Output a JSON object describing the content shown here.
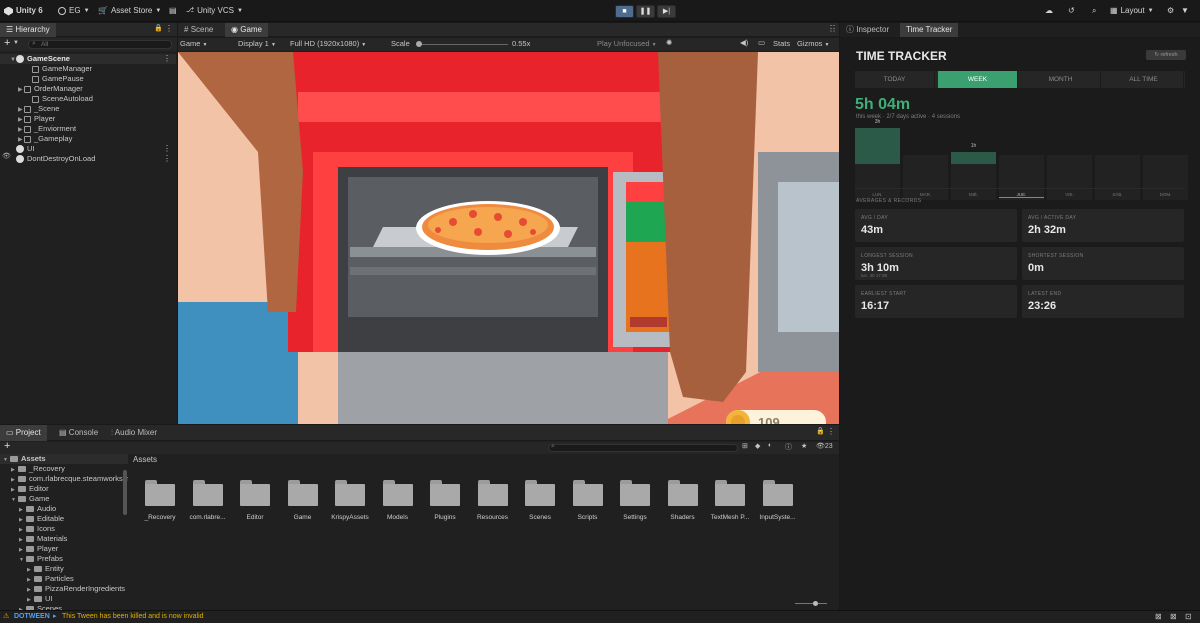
{
  "toolbar": {
    "app": "Unity 6",
    "account": "EG",
    "asset_store": "Asset Store",
    "vcs": "Unity VCS",
    "layout": "Layout"
  },
  "hierarchy": {
    "tab": "Hierarchy",
    "search_placeholder": "All",
    "items": [
      {
        "label": "GameScene",
        "depth": 0,
        "kind": "scene"
      },
      {
        "label": "GameManager",
        "depth": 2,
        "kind": "obj"
      },
      {
        "label": "GamePause",
        "depth": 2,
        "kind": "obj"
      },
      {
        "label": "OrderManager",
        "depth": 1,
        "kind": "obj"
      },
      {
        "label": "SceneAutoload",
        "depth": 2,
        "kind": "obj"
      },
      {
        "label": "_Scene",
        "depth": 1,
        "kind": "obj"
      },
      {
        "label": "Player",
        "depth": 1,
        "kind": "obj"
      },
      {
        "label": "_Enviorment",
        "depth": 1,
        "kind": "obj"
      },
      {
        "label": "_Gameplay",
        "depth": 1,
        "kind": "obj"
      },
      {
        "label": "UI",
        "depth": 0,
        "kind": "unity"
      },
      {
        "label": "DontDestroyOnLoad",
        "depth": 0,
        "kind": "unity"
      }
    ]
  },
  "views": {
    "scene_tab": "Scene",
    "game_tab": "Game",
    "game_dropdown": "Game",
    "display": "Display 1",
    "resolution": "Full HD (1920x1080)",
    "scale_label": "Scale",
    "scale_value": "0.55x",
    "play_mode": "Play Unfocused",
    "stats": "Stats",
    "gizmos": "Gizmos",
    "coin_count": "109"
  },
  "project": {
    "tabs": [
      "Project",
      "Console",
      "Audio Mixer"
    ],
    "count": "23",
    "breadcrumb": "Assets",
    "tree": [
      {
        "label": "Assets",
        "depth": 0,
        "open": true
      },
      {
        "label": "_Recovery",
        "depth": 1
      },
      {
        "label": "com.rlabrecque.steamworks.net",
        "depth": 1
      },
      {
        "label": "Editor",
        "depth": 1
      },
      {
        "label": "Game",
        "depth": 1,
        "open": true
      },
      {
        "label": "Audio",
        "depth": 2
      },
      {
        "label": "Editable",
        "depth": 2
      },
      {
        "label": "Icons",
        "depth": 2
      },
      {
        "label": "Materials",
        "depth": 2
      },
      {
        "label": "Player",
        "depth": 2
      },
      {
        "label": "Prefabs",
        "depth": 2,
        "open": true
      },
      {
        "label": "Entity",
        "depth": 3
      },
      {
        "label": "Particles",
        "depth": 3
      },
      {
        "label": "PizzaRenderIngredients",
        "depth": 3
      },
      {
        "label": "UI",
        "depth": 3
      },
      {
        "label": "Scenes",
        "depth": 2
      }
    ],
    "folders": [
      "_Recovery",
      "com.rlabre...",
      "Editor",
      "Game",
      "KrispyAssets",
      "Models",
      "Plugins",
      "Resources",
      "Scenes",
      "Scripts",
      "Settings",
      "Shaders",
      "TextMesh P...",
      "InputSyste..."
    ]
  },
  "inspector": {
    "tabs": [
      "Inspector",
      "Time Tracker"
    ],
    "title": "TIME TRACKER",
    "refresh": "refresh",
    "periods": [
      "TODAY",
      "WEEK",
      "MONTH",
      "ALL TIME"
    ],
    "total": "5h 04m",
    "sub": "this week · 2/7 days active · 4 sessions",
    "days": [
      {
        "label": "LUN.",
        "hours": 3,
        "bar_label": "3h"
      },
      {
        "label": "MAR.",
        "hours": 0,
        "bar_label": ""
      },
      {
        "label": "MIÉ.",
        "hours": 1,
        "bar_label": "1h"
      },
      {
        "label": "JUE.",
        "hours": 0,
        "bar_label": "",
        "today": true
      },
      {
        "label": "VIE.",
        "hours": 0,
        "bar_label": ""
      },
      {
        "label": "SÁB.",
        "hours": 0,
        "bar_label": ""
      },
      {
        "label": "DOM.",
        "hours": 0,
        "bar_label": ""
      }
    ],
    "section": "AVERAGES & RECORDS",
    "stats": [
      {
        "key": "AVG / DAY",
        "value": "43m",
        "sub": ""
      },
      {
        "key": "AVG / ACTIVE DAY",
        "value": "2h 32m",
        "sub": ""
      },
      {
        "key": "LONGEST SESSION",
        "value": "3h 10m",
        "sub": "lun. 30 17:38"
      },
      {
        "key": "SHORTEST SESSION",
        "value": "0m",
        "sub": ""
      },
      {
        "key": "EARLIEST START",
        "value": "16:17",
        "sub": ""
      },
      {
        "key": "LATEST END",
        "value": "23:26",
        "sub": ""
      }
    ]
  },
  "status": {
    "tag": "DOTWEEN",
    "message": "This Tween has been killed and is now invalid"
  },
  "colors": {
    "accent_green": "#3fae77",
    "week_tab": "#3aa070",
    "status_warn": "#e0b000"
  }
}
